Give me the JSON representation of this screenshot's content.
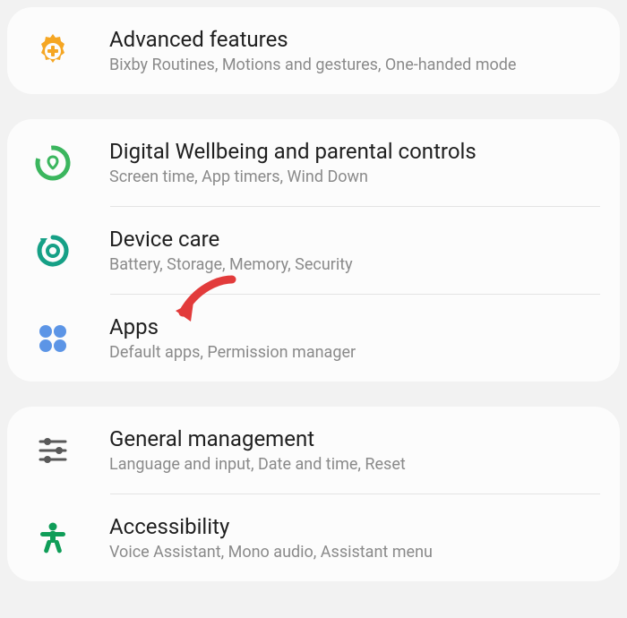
{
  "groups": [
    {
      "items": [
        {
          "key": "advanced_features",
          "icon": "gear-plus",
          "title": "Advanced features",
          "subtitle": "Bixby Routines, Motions and gestures, One-handed mode"
        }
      ]
    },
    {
      "items": [
        {
          "key": "digital_wellbeing",
          "icon": "wellbeing",
          "title": "Digital Wellbeing and parental controls",
          "subtitle": "Screen time, App timers, Wind Down"
        },
        {
          "key": "device_care",
          "icon": "device-care",
          "title": "Device care",
          "subtitle": "Battery, Storage, Memory, Security"
        },
        {
          "key": "apps",
          "icon": "apps-grid",
          "title": "Apps",
          "subtitle": "Default apps, Permission manager",
          "arrow": true
        }
      ]
    },
    {
      "items": [
        {
          "key": "general_management",
          "icon": "sliders",
          "title": "General management",
          "subtitle": "Language and input, Date and time, Reset"
        },
        {
          "key": "accessibility",
          "icon": "accessibility",
          "title": "Accessibility",
          "subtitle": "Voice Assistant, Mono audio, Assistant menu"
        }
      ]
    }
  ]
}
